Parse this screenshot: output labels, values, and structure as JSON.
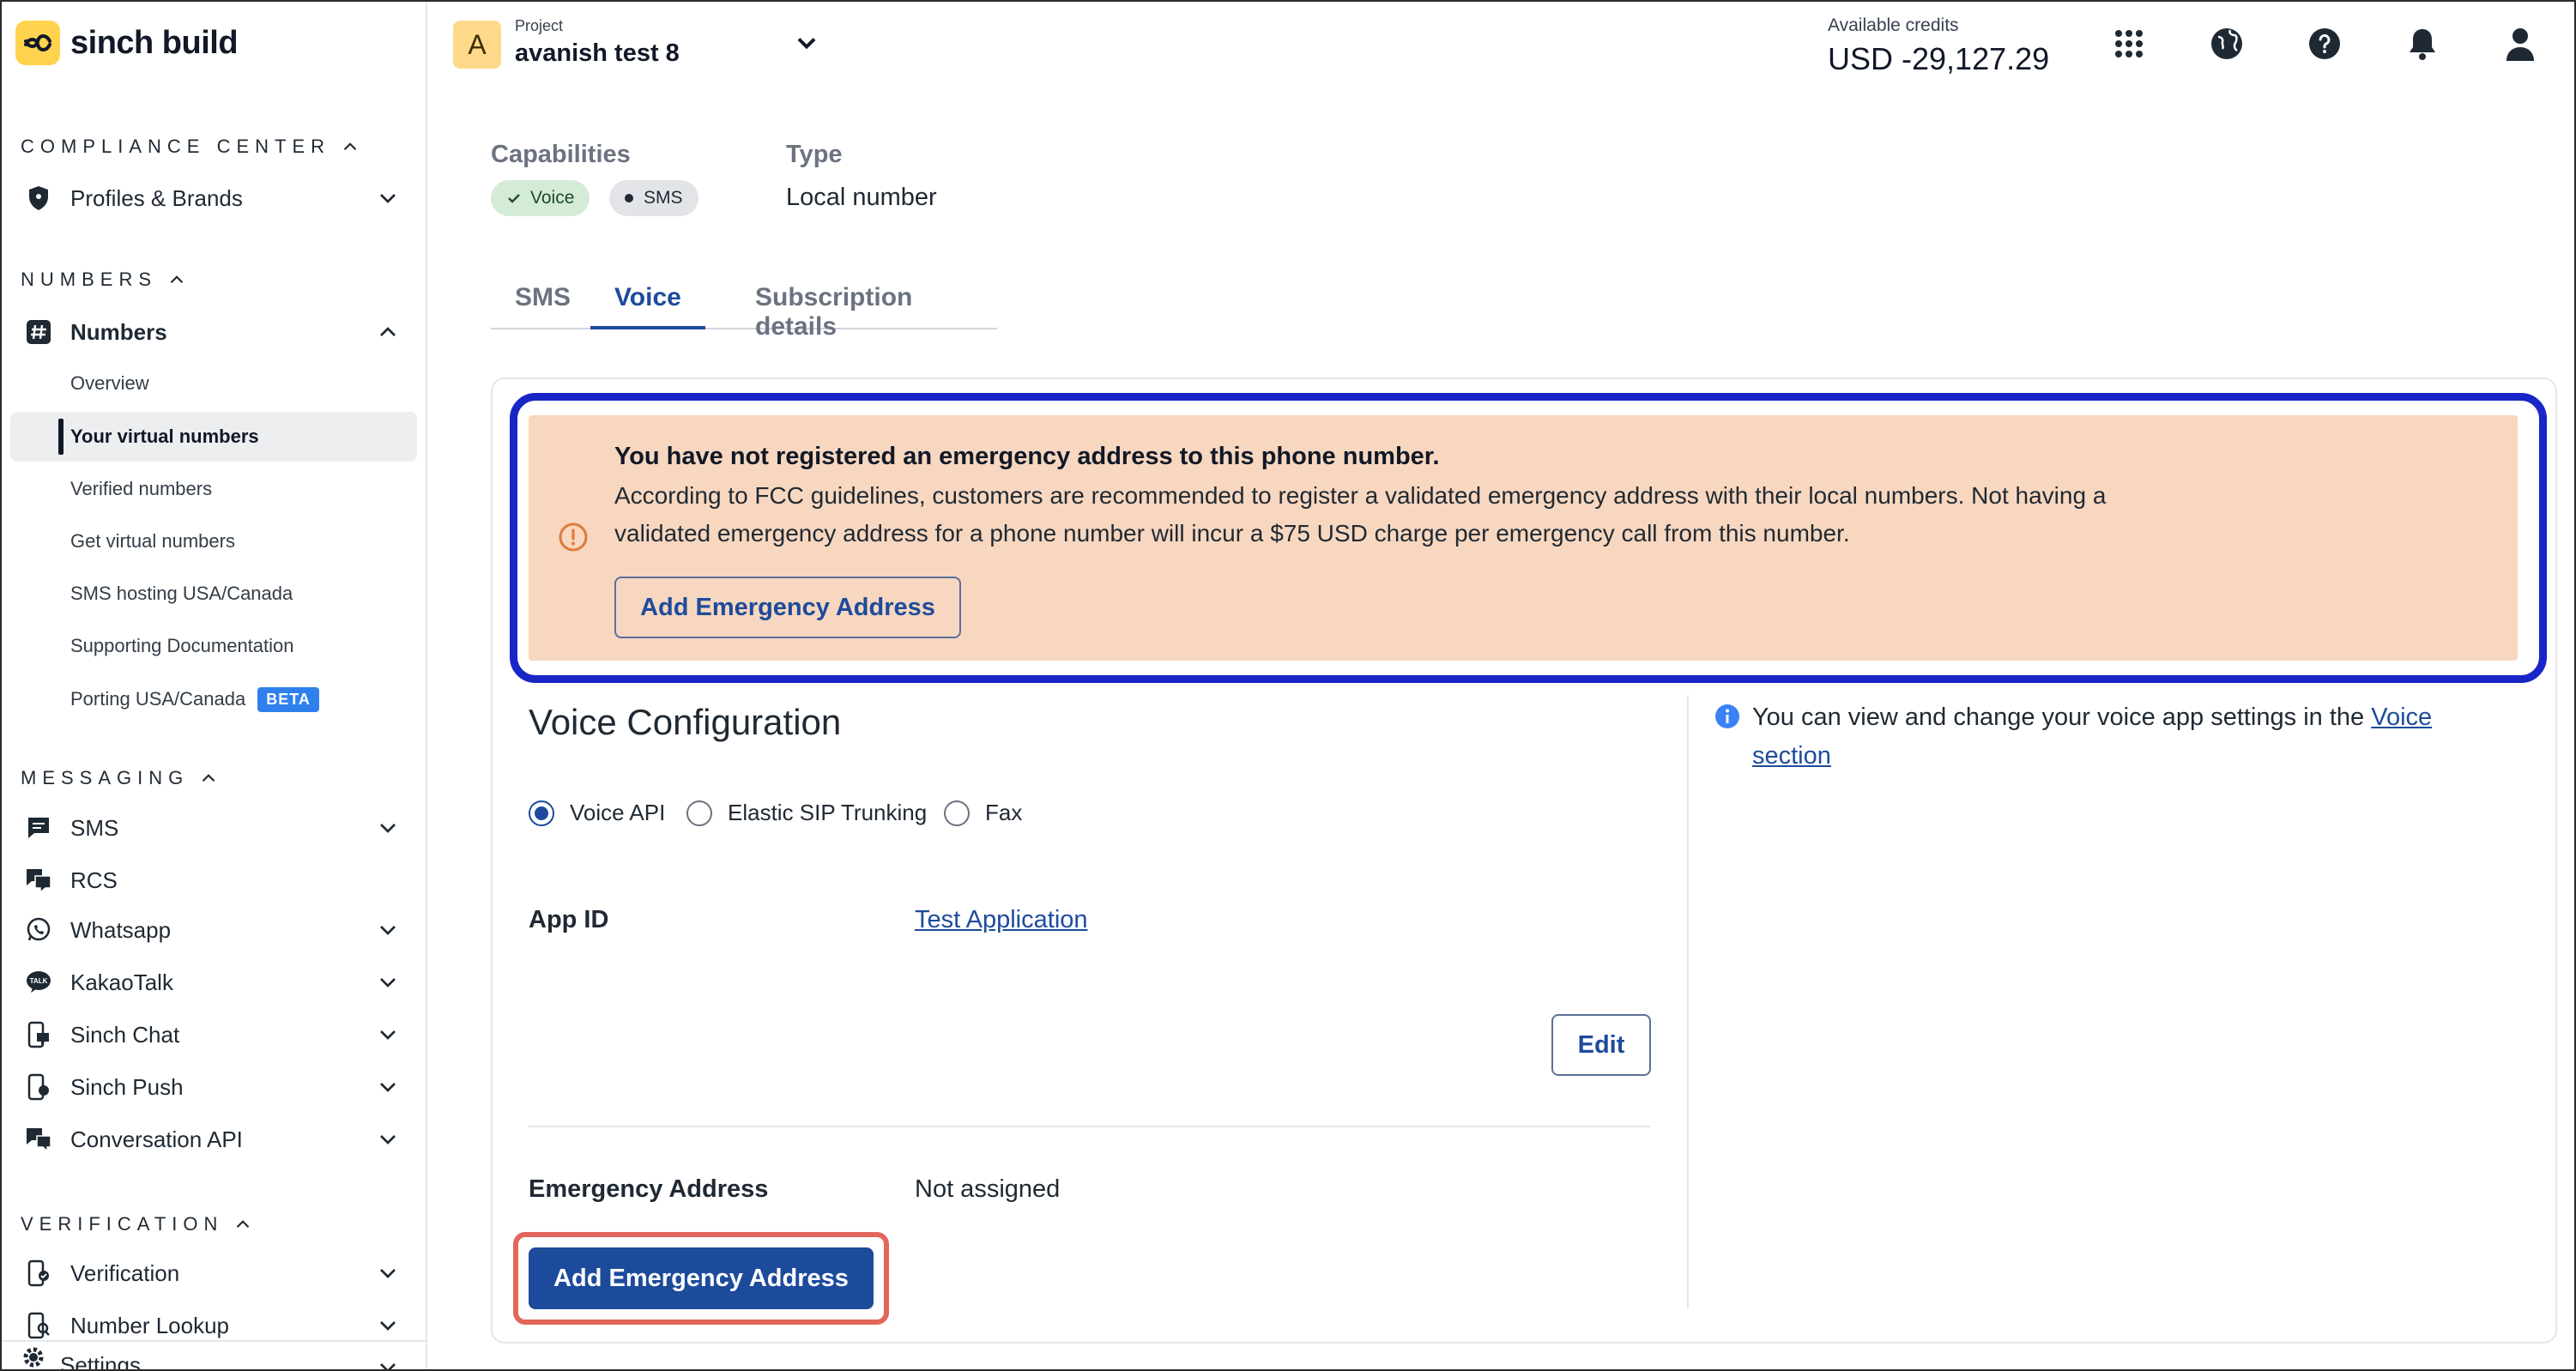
{
  "app": {
    "logo_text": "sinch build"
  },
  "sidebar": {
    "sections": [
      {
        "title": "COMPLIANCE CENTER"
      },
      {
        "title": "NUMBERS"
      },
      {
        "title": "MESSAGING"
      },
      {
        "title": "VERIFICATION"
      }
    ],
    "compliance": {
      "profiles": "Profiles & Brands"
    },
    "numbers": {
      "label": "Numbers",
      "subitems": [
        "Overview",
        "Your virtual numbers",
        "Verified numbers",
        "Get virtual numbers",
        "SMS hosting USA/Canada",
        "Supporting Documentation",
        "Porting USA/Canada"
      ],
      "beta": "BETA"
    },
    "messaging": [
      "SMS",
      "RCS",
      "Whatsapp",
      "KakaoTalk",
      "Sinch Chat",
      "Sinch Push",
      "Conversation API"
    ],
    "verification": [
      "Verification",
      "Number Lookup"
    ],
    "settings": "Settings"
  },
  "header": {
    "project_initial": "A",
    "project_caption": "Project",
    "project_name": "avanish test 8",
    "credits_caption": "Available credits",
    "credits_value": "USD -29,127.29",
    "icons": [
      "apps-grid-icon",
      "globe-icon",
      "help-icon",
      "bell-icon",
      "user-icon"
    ]
  },
  "main": {
    "capabilities_label": "Capabilities",
    "type_label": "Type",
    "chips": [
      "Voice",
      "SMS"
    ],
    "type_value": "Local number",
    "tabs": [
      "SMS",
      "Voice",
      "Subscription details"
    ],
    "active_tab": "Voice",
    "alert": {
      "title": "You have not registered an emergency address to this phone number.",
      "body": "According to FCC guidelines, customers are recommended to register a validated emergency address with their local numbers. Not having a validated emergency address for a phone number will incur a $75 USD charge per emergency call from this number.",
      "button": "Add Emergency Address"
    },
    "voice_config": {
      "title": "Voice Configuration",
      "options": [
        "Voice API",
        "Elastic SIP Trunking",
        "Fax"
      ],
      "selected": "Voice API",
      "app_id_label": "App ID",
      "app_id_value": "Test Application",
      "edit_button": "Edit",
      "emergency_label": "Emergency Address",
      "emergency_value": "Not assigned",
      "add_button": "Add Emergency Address"
    },
    "info": {
      "text": "You can view and change your voice app settings in the ",
      "link": "Voice section"
    }
  },
  "colors": {
    "accent": "#1d4b9c",
    "alert_bg": "#f7d7bf",
    "highlight_blue": "#1826c7",
    "highlight_red": "#e2665a",
    "brand_yellow": "#ffd34d"
  }
}
